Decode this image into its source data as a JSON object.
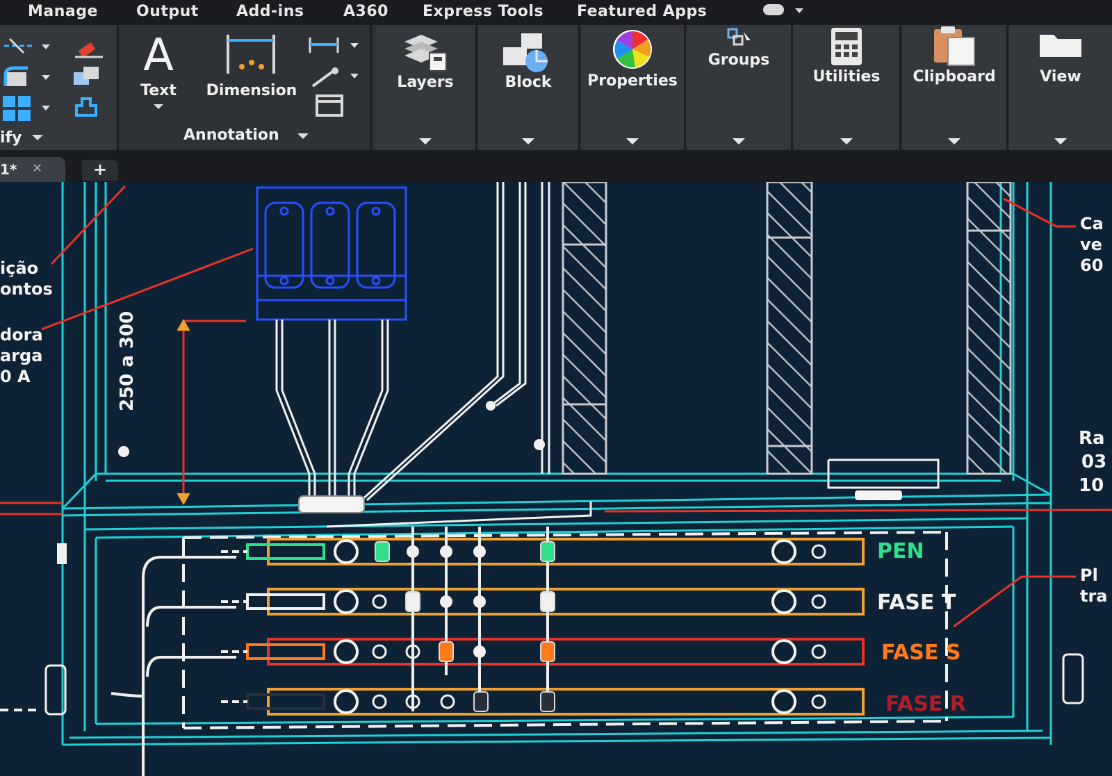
{
  "menu": [
    "Manage",
    "Output",
    "Add-ins",
    "A360",
    "Express Tools",
    "Featured Apps"
  ],
  "ribbon": {
    "modify_label": "ify",
    "annotation": {
      "panel_label": "Annotation",
      "text_label": "Text",
      "text_glyph": "A",
      "dimension_label": "Dimension"
    },
    "panels": [
      {
        "label": "Layers",
        "icon": "layers-icon"
      },
      {
        "label": "Block",
        "icon": "block-icon"
      },
      {
        "label": "Properties",
        "icon": "color-wheel-icon"
      },
      {
        "label": "Groups",
        "icon": "groups-icon"
      },
      {
        "label": "Utilities",
        "icon": "calculator-icon"
      },
      {
        "label": "Clipboard",
        "icon": "clipboard-icon"
      },
      {
        "label": "View",
        "icon": "folder-icon"
      }
    ]
  },
  "tabs": {
    "active_label": "1*",
    "close_glyph": "✕",
    "add_glyph": "+"
  },
  "drawing": {
    "dimension_text": "250 a 300",
    "left_notes": [
      "ição",
      "ontos",
      "dora",
      "arga",
      "0 A"
    ],
    "right_notes_top": [
      "Ca",
      "ve",
      "60"
    ],
    "right_notes_mid": [
      "Ra",
      "03",
      "10"
    ],
    "right_notes_bottom": [
      "Pl",
      "tra"
    ],
    "busbars": [
      {
        "label": "PEN",
        "color": "#2ee08a"
      },
      {
        "label": "FASE T",
        "color": "#f2f2f2"
      },
      {
        "label": "FASE S",
        "color": "#ff7a1a"
      },
      {
        "label": "FASE R",
        "color": "#b01c28"
      }
    ]
  },
  "colors": {
    "canvas": "#0e2236",
    "cyan": "#1fd0d4",
    "orange": "#f0a030",
    "red": "#e8332a",
    "blue": "#2a4dff",
    "hatch": "#b8bcc0",
    "wire": "#f0f0f0"
  }
}
